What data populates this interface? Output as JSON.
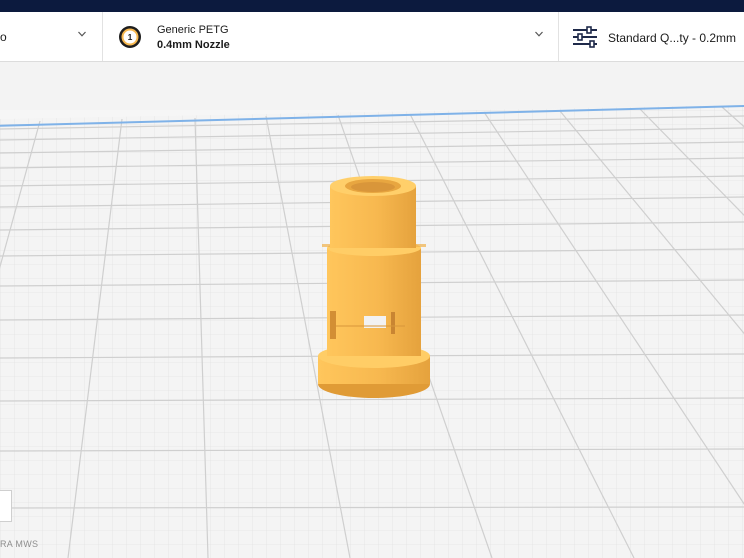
{
  "header": {
    "printer_fragment": "o",
    "material": {
      "name": "Generic PETG",
      "nozzle": "0.4mm Nozzle",
      "extruder_number": "1"
    },
    "profile": {
      "label": "Standard Q...ty - 0.2mm"
    }
  },
  "viewport": {
    "machine_label": "RA MWS"
  },
  "colors": {
    "model": "#f7b84f",
    "top_bar": "#0c1a3e",
    "build_plate": "#f4f4f4",
    "grid": "#d6d6d6"
  },
  "icons": [
    "chevron-down-icon",
    "extruder-nozzle-icon",
    "settings-sliders-icon"
  ]
}
